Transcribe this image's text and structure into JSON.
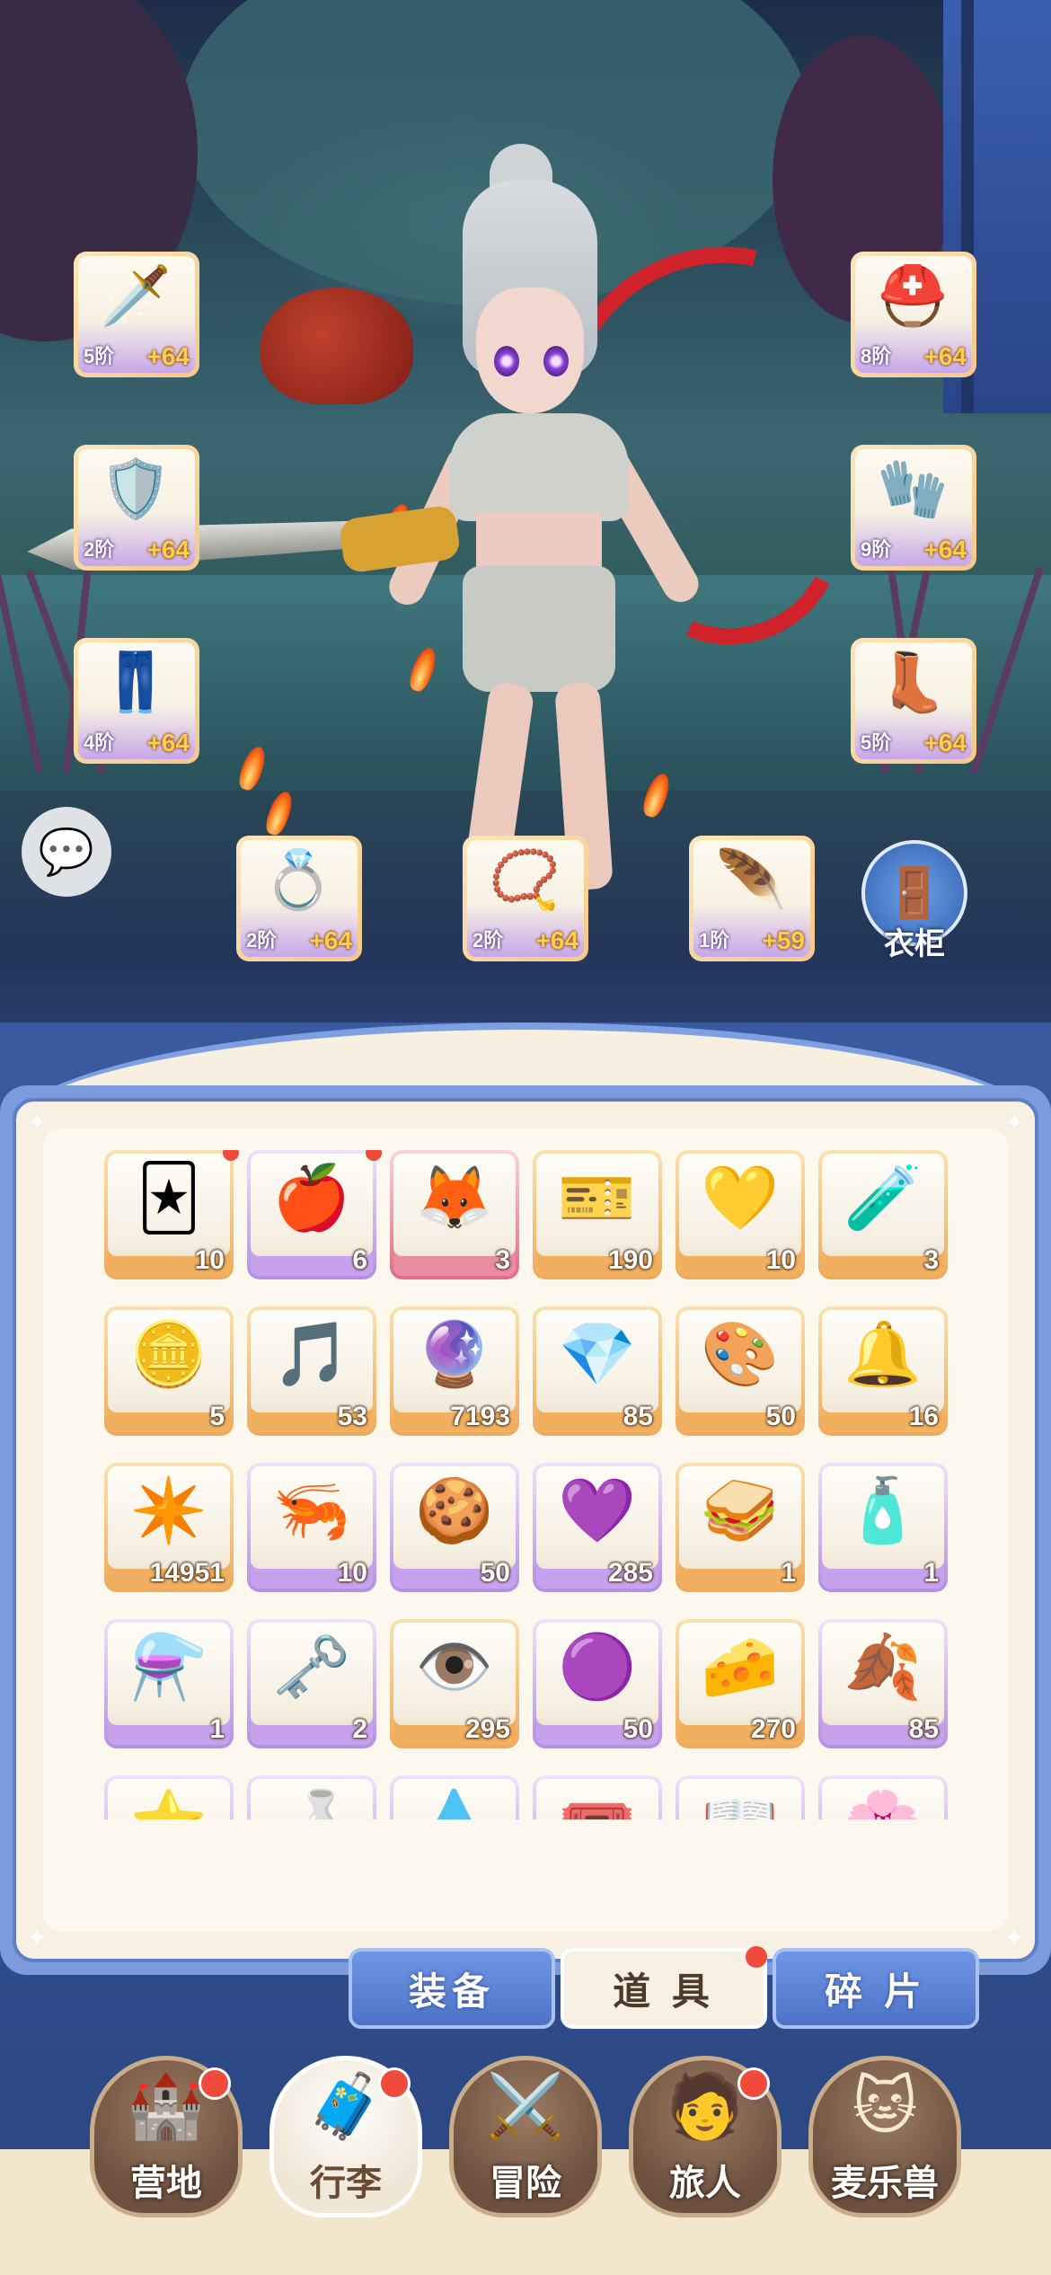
{
  "equipment": {
    "left": [
      {
        "icon": "sword-icon",
        "glyph": "🗡️",
        "tier": "5阶",
        "bonus": "+64"
      },
      {
        "icon": "armor-icon",
        "glyph": "🛡️",
        "tier": "2阶",
        "bonus": "+64"
      },
      {
        "icon": "pants-icon",
        "glyph": "👖",
        "tier": "4阶",
        "bonus": "+64"
      }
    ],
    "right": [
      {
        "icon": "helmet-icon",
        "glyph": "⛑️",
        "tier": "8阶",
        "bonus": "+64"
      },
      {
        "icon": "gauntlet-icon",
        "glyph": "🧤",
        "tier": "9阶",
        "bonus": "+64"
      },
      {
        "icon": "boots-icon",
        "glyph": "👢",
        "tier": "5阶",
        "bonus": "+64"
      }
    ],
    "bottom": [
      {
        "icon": "ring-icon",
        "glyph": "💍",
        "tier": "2阶",
        "bonus": "+64"
      },
      {
        "icon": "necklace-icon",
        "glyph": "📿",
        "tier": "2阶",
        "bonus": "+64"
      },
      {
        "icon": "charm-icon",
        "glyph": "🪶",
        "tier": "1阶",
        "bonus": "+59"
      }
    ]
  },
  "wardrobe": {
    "label": "衣柜"
  },
  "items": [
    {
      "name": "card",
      "glyph": "🃏",
      "count": "10",
      "rarity": "orange",
      "badge": true
    },
    {
      "name": "apple",
      "glyph": "🍎",
      "count": "6",
      "rarity": "purple",
      "badge": true
    },
    {
      "name": "fox-portrait",
      "glyph": "🦊",
      "count": "3",
      "rarity": "pink",
      "badge": false
    },
    {
      "name": "ticket",
      "glyph": "🎫",
      "count": "190",
      "rarity": "orange",
      "badge": false
    },
    {
      "name": "yellow-gem",
      "glyph": "💛",
      "count": "10",
      "rarity": "orange",
      "badge": false
    },
    {
      "name": "blue-potion",
      "glyph": "🧪",
      "count": "3",
      "rarity": "orange",
      "badge": false
    },
    {
      "name": "cat-coin",
      "glyph": "🪙",
      "count": "5",
      "rarity": "orange",
      "badge": false
    },
    {
      "name": "lyre",
      "glyph": "🎵",
      "count": "53",
      "rarity": "orange",
      "badge": false
    },
    {
      "name": "rune-orb",
      "glyph": "🔮",
      "count": "7193",
      "rarity": "orange",
      "badge": false
    },
    {
      "name": "crystal",
      "glyph": "💎",
      "count": "85",
      "rarity": "orange",
      "badge": false
    },
    {
      "name": "paint-tube",
      "glyph": "🎨",
      "count": "50",
      "rarity": "orange",
      "badge": false
    },
    {
      "name": "bell",
      "glyph": "🔔",
      "count": "16",
      "rarity": "orange",
      "badge": false
    },
    {
      "name": "star-crystal",
      "glyph": "✴️",
      "count": "14951",
      "rarity": "orange",
      "badge": false
    },
    {
      "name": "shrimp",
      "glyph": "🦐",
      "count": "10",
      "rarity": "purple",
      "badge": false
    },
    {
      "name": "cookie",
      "glyph": "🍪",
      "count": "50",
      "rarity": "purple",
      "badge": false
    },
    {
      "name": "heart-coin",
      "glyph": "💜",
      "count": "285",
      "rarity": "purple",
      "badge": false
    },
    {
      "name": "sandwich",
      "glyph": "🥪",
      "count": "1",
      "rarity": "orange",
      "badge": false
    },
    {
      "name": "potion-bottle",
      "glyph": "🧴",
      "count": "1",
      "rarity": "purple",
      "badge": false
    },
    {
      "name": "red-potion",
      "glyph": "⚗️",
      "count": "1",
      "rarity": "purple",
      "badge": false
    },
    {
      "name": "key",
      "glyph": "🗝️",
      "count": "2",
      "rarity": "purple",
      "badge": false
    },
    {
      "name": "eye-card",
      "glyph": "👁️",
      "count": "295",
      "rarity": "orange",
      "badge": false
    },
    {
      "name": "cat-orb",
      "glyph": "🟣",
      "count": "50",
      "rarity": "purple",
      "badge": false
    },
    {
      "name": "cheese",
      "glyph": "🧀",
      "count": "270",
      "rarity": "orange",
      "badge": false
    },
    {
      "name": "gold-leaf",
      "glyph": "🍂",
      "count": "85",
      "rarity": "purple",
      "badge": false
    },
    {
      "name": "star-hat",
      "glyph": "⭐",
      "count": "",
      "rarity": "purple",
      "badge": false
    },
    {
      "name": "bottle",
      "glyph": "🍶",
      "count": "",
      "rarity": "purple",
      "badge": false
    },
    {
      "name": "blue-slime",
      "glyph": "💧",
      "count": "",
      "rarity": "purple",
      "badge": false
    },
    {
      "name": "ticket-2",
      "glyph": "🎟️",
      "count": "",
      "rarity": "purple",
      "badge": false
    },
    {
      "name": "book",
      "glyph": "📖",
      "count": "",
      "rarity": "purple",
      "badge": false
    },
    {
      "name": "blue-flower",
      "glyph": "🌸",
      "count": "",
      "rarity": "purple",
      "badge": false
    }
  ],
  "tabs": [
    {
      "label": "装备",
      "active": false,
      "badge": false
    },
    {
      "label": "道 具",
      "active": true,
      "badge": true
    },
    {
      "label": "碎 片",
      "active": false,
      "badge": false
    }
  ],
  "nav": [
    {
      "label": "营地",
      "glyph": "🏰",
      "icon": "castle-icon",
      "active": false,
      "badge": true
    },
    {
      "label": "行李",
      "glyph": "🧳",
      "icon": "luggage-icon",
      "active": true,
      "badge": true
    },
    {
      "label": "冒险",
      "glyph": "⚔️",
      "icon": "crossed-swords-icon",
      "active": false,
      "badge": false
    },
    {
      "label": "旅人",
      "glyph": "🧑",
      "icon": "traveler-icon",
      "active": false,
      "badge": true
    },
    {
      "label": "麦乐兽",
      "glyph": "🐱",
      "icon": "cat-icon",
      "active": false,
      "badge": false
    }
  ],
  "colors": {
    "badge": "#ef4a3a",
    "panel_border": "#5d7fc8",
    "tab_active": "#f8f1e3",
    "tab_inactive": "#4d73c8"
  }
}
